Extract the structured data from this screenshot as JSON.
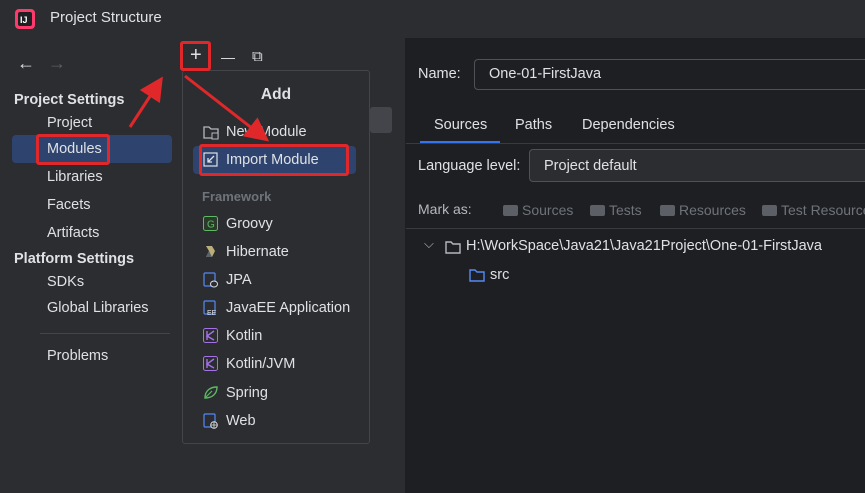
{
  "window": {
    "title": "Project Structure",
    "logo_text": "IJ"
  },
  "sidebar": {
    "back_icon": "←",
    "forward_icon": "→",
    "project_settings_heading": "Project Settings",
    "project_items": [
      "Project",
      "Modules",
      "Libraries",
      "Facets",
      "Artifacts"
    ],
    "platform_settings_heading": "Platform Settings",
    "platform_items": [
      "SDKs",
      "Global Libraries"
    ],
    "problems": "Problems",
    "selected": "Modules"
  },
  "toolbar": {
    "add_icon": "+",
    "remove_icon": "—",
    "copy_icon": "⧉"
  },
  "popup": {
    "title": "Add",
    "items": [
      "New Module",
      "Import Module"
    ],
    "framework_heading": "Framework",
    "frameworks": [
      "Groovy",
      "Hibernate",
      "JPA",
      "JavaEE Application",
      "Kotlin",
      "Kotlin/JVM",
      "Spring",
      "Web"
    ],
    "selected": "Import Module"
  },
  "module": {
    "name_label": "Name:",
    "name_value": "One-01-FirstJava",
    "tabs": [
      "Sources",
      "Paths",
      "Dependencies"
    ],
    "active_tab": "Sources",
    "language_level_label": "Language level:",
    "language_level_value": "Project default",
    "mark_as_label": "Mark as:",
    "mark_as_options": [
      "Sources",
      "Tests",
      "Resources",
      "Test Resources"
    ],
    "tree": {
      "root": "H:\\WorkSpace\\Java21\\Java21Project\\One-01-FirstJava",
      "children": [
        "src"
      ]
    }
  },
  "colors": {
    "background": "#1e1f22",
    "panel": "#2b2d30",
    "selection": "#2e436e",
    "accent": "#3574f0",
    "annotation_red": "#e0282b"
  }
}
